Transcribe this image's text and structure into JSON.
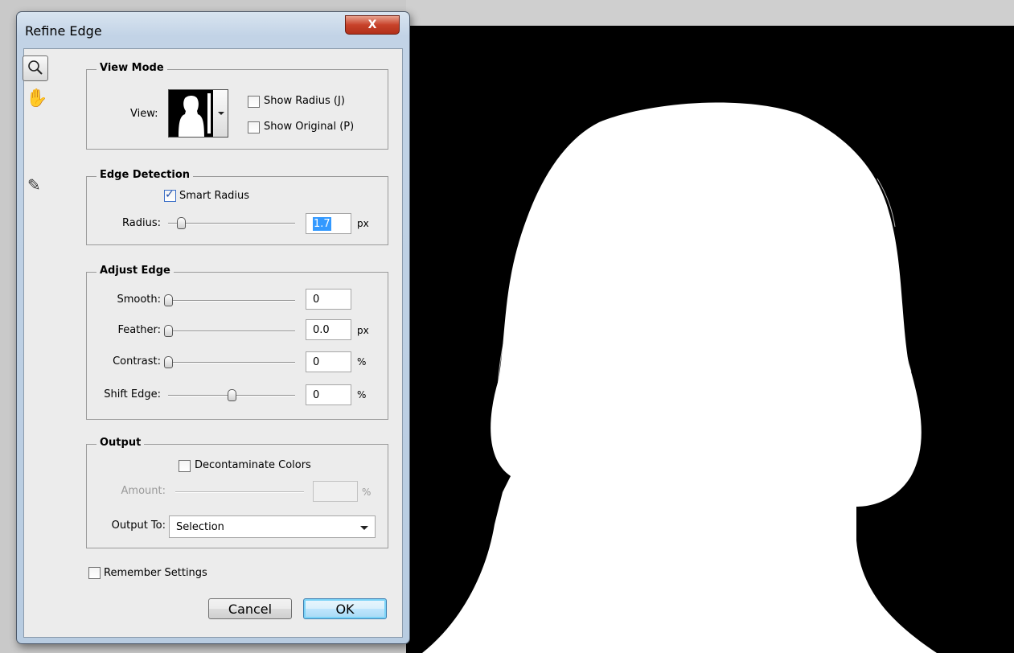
{
  "dialog": {
    "title": "Refine Edge",
    "close_label": "X"
  },
  "tools": {
    "zoom": "zoom-icon",
    "hand": "hand-icon",
    "refine_brush": "refine-radius-brush-icon"
  },
  "view_mode": {
    "legend": "View Mode",
    "view_label": "View:",
    "show_radius": {
      "label": "Show Radius (J)",
      "checked": false
    },
    "show_original": {
      "label": "Show Original (P)",
      "checked": false
    }
  },
  "edge_detection": {
    "legend": "Edge Detection",
    "smart_radius": {
      "label": "Smart Radius",
      "checked": true
    },
    "radius": {
      "label": "Radius:",
      "value": "1.7",
      "unit": "px",
      "slider_fraction": 0.1
    }
  },
  "adjust_edge": {
    "legend": "Adjust Edge",
    "smooth": {
      "label": "Smooth:",
      "value": "0",
      "unit": "",
      "slider_fraction": 0.0
    },
    "feather": {
      "label": "Feather:",
      "value": "0.0",
      "unit": "px",
      "slider_fraction": 0.0
    },
    "contrast": {
      "label": "Contrast:",
      "value": "0",
      "unit": "%",
      "slider_fraction": 0.0
    },
    "shift_edge": {
      "label": "Shift Edge:",
      "value": "0",
      "unit": "%",
      "slider_fraction": 0.5
    }
  },
  "output": {
    "legend": "Output",
    "decontaminate": {
      "label": "Decontaminate Colors",
      "checked": false
    },
    "amount": {
      "label": "Amount:",
      "value": "",
      "unit": "%"
    },
    "output_to_label": "Output To:",
    "output_to_value": "Selection"
  },
  "remember_settings": {
    "label": "Remember Settings",
    "checked": false
  },
  "buttons": {
    "cancel": "Cancel",
    "ok": "OK"
  },
  "colors": {
    "selection_highlight": "#3399ff",
    "close_button": "#c7422a",
    "mask_background": "#000000",
    "mask_foreground": "#ffffff"
  }
}
